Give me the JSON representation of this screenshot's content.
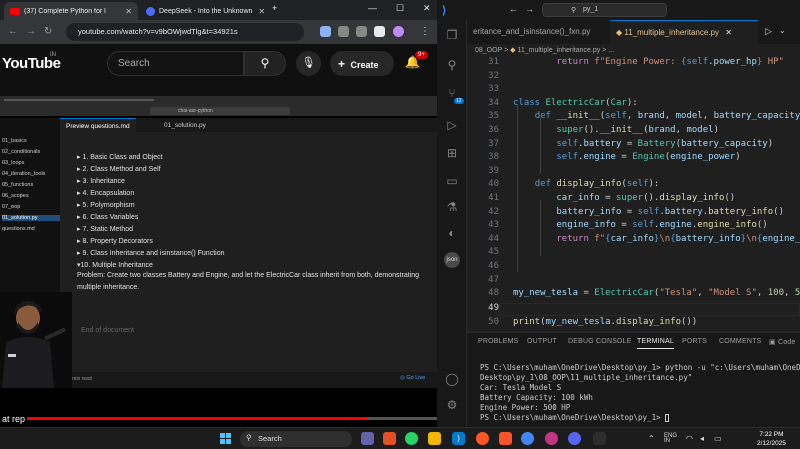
{
  "browser": {
    "tabs": [
      {
        "label": "(37) Complete Python for l",
        "icon": "youtube-icon"
      },
      {
        "label": "DeepSeek - Into the Unknown",
        "icon": "deepseek-icon"
      }
    ],
    "url": "youtube.com/watch?v=v9bOWjwdTlg&t=34921s",
    "youtube": {
      "logo_text": "YouTube",
      "country": "IN",
      "search_placeholder": "Search",
      "create_label": "Create",
      "notif_count": "9+"
    },
    "video": {
      "inner_search": "chai-aur-python",
      "tree_items": [
        "01_basics",
        "02_conditionals",
        "03_loops",
        "04_iteration_tools",
        "05_functions",
        "06_scopes",
        "07_oop",
        "01_solution.py",
        "questions.md"
      ],
      "tabs": [
        "Preview questions.md",
        "01_solution.py"
      ],
      "topics": [
        "▸ 1. Basic Class and Object",
        "▸ 2. Class Method and Self",
        "▸ 3. Inheritance",
        "▸ 4. Encapsulation",
        "▸ 5. Polymorphism",
        "▸ 6. Class Variables",
        "▸ 7. Static Method",
        "▸ 8. Property Decorators",
        "▸ 9. Class Inheritance and isinstance() Function",
        "▾10. Multiple Inheritance"
      ],
      "problem_line1": "Problem: Create two classes Battery and Engine, and let the ElectricCar class inherit from both, demonstrating",
      "problem_line2": "multiple inheritance.",
      "end_of_document": "End of document",
      "read_time": "2 min read",
      "go_live": "Go Live",
      "subtitle": "at rep",
      "progress": 0.84
    }
  },
  "vscode": {
    "search": "py_1",
    "tabs": [
      "eritance_and_isinstance()_fxn.py",
      "11_multiple_inheritance.py"
    ],
    "breadcrumb": [
      "08_OOP",
      "11_multiple_inheritance.py",
      "..."
    ],
    "line_numbers": [
      "31",
      "32",
      "33",
      "34",
      "35",
      "36",
      "37",
      "38",
      "39",
      "40",
      "41",
      "42",
      "43",
      "44",
      "45",
      "46",
      "47",
      "48",
      "49",
      "50"
    ],
    "current_line": "49",
    "panel_tabs": [
      "PROBLEMS",
      "OUTPUT",
      "DEBUG CONSOLE",
      "TERMINAL",
      "PORTS",
      "COMMENTS"
    ],
    "panel_code_label": "Code",
    "terminal": [
      "PS C:\\Users\\muham\\OneDrive\\Desktop\\py_1> python -u \"c:\\Users\\muham\\OneDrive",
      "Desktop\\py_1\\08_OOP\\11_multiple_inheritance.py\"",
      "Car: Tesla Model S",
      "Battery Capacity: 100 kWh",
      "Engine Power: 500 HP",
      "PS C:\\Users\\muham\\OneDrive\\Desktop\\py_1> "
    ],
    "activity_badge": "12",
    "json_label": "json"
  },
  "taskbar": {
    "search_placeholder": "Search",
    "time": "7:22 PM",
    "date": "2/12/2025",
    "lang": "ENG\nIN"
  }
}
